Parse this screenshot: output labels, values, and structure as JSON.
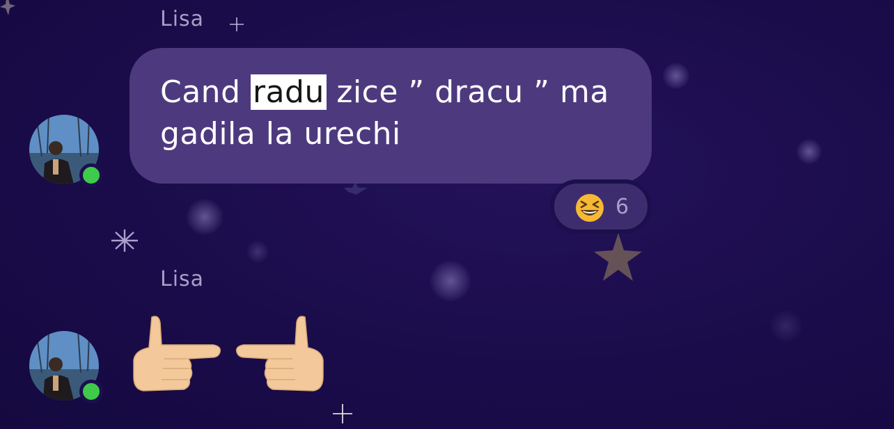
{
  "messages": [
    {
      "sender": "Lisa",
      "text_before": "Cand ",
      "text_highlight": "radu",
      "text_after": " zice ” dracu ” ma gadila la urechi",
      "reaction": {
        "emoji": "grinning-squinting-face",
        "count": "6"
      },
      "online": true
    },
    {
      "sender": "Lisa",
      "emoji_message": "pointing-fingers-toward-each-other",
      "online": true
    }
  ],
  "colors": {
    "background": "#1a0c4a",
    "bubble": "#4d3a7e",
    "reaction_pill": "#3e2d6e",
    "online": "#3ecb4b",
    "sender_name": "#a79fc8"
  }
}
